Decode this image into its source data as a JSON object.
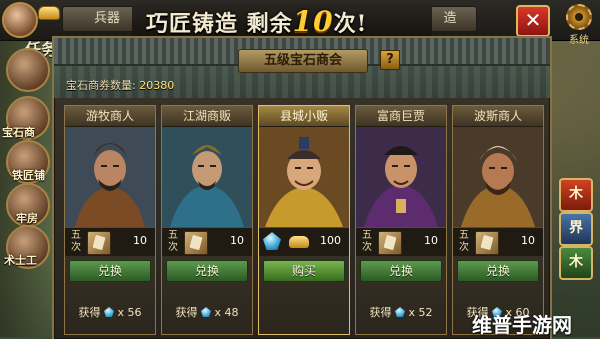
{
  "top_bar": {
    "left_tab": "兵器",
    "right_tab": "造",
    "banner_prefix": "巧匠铸造 剩余",
    "banner_count": "10",
    "banner_suffix": "次!",
    "close_label": "✕",
    "system_label": "系统"
  },
  "left_hud": {
    "vertical_title": "任务",
    "items": [
      "宝石商",
      "铁匠铺",
      "牢房",
      "术士工"
    ]
  },
  "right_hud": {
    "buttons": [
      "木",
      "界",
      "木"
    ]
  },
  "panel": {
    "title": "五级宝石商会",
    "help_label": "?",
    "currency_label": "宝石商券数量:",
    "currency_value": "20380"
  },
  "merchants": [
    {
      "name": "游牧商人",
      "times_label": "五次",
      "price": "10",
      "action": "兑换",
      "obtain_label": "获得",
      "obtain_amount": "x 56",
      "type": "exchange"
    },
    {
      "name": "江湖商贩",
      "times_label": "五次",
      "price": "10",
      "action": "兑换",
      "obtain_label": "获得",
      "obtain_amount": "x 48",
      "type": "exchange"
    },
    {
      "name": "县城小贩",
      "times_label": "",
      "price": "100",
      "action": "购买",
      "obtain_label": "",
      "obtain_amount": "",
      "type": "buy"
    },
    {
      "name": "富商巨贾",
      "times_label": "五次",
      "price": "10",
      "action": "兑换",
      "obtain_label": "获得",
      "obtain_amount": "x 52",
      "type": "exchange"
    },
    {
      "name": "波斯商人",
      "times_label": "五次",
      "price": "10",
      "action": "兑换",
      "obtain_label": "获得",
      "obtain_amount": "x 60",
      "type": "exchange"
    }
  ],
  "watermark": "维普手游网",
  "colors": {
    "accent_gold": "#ffcc33",
    "button_green": "#5e9a4f",
    "close_red": "#d8382a"
  }
}
